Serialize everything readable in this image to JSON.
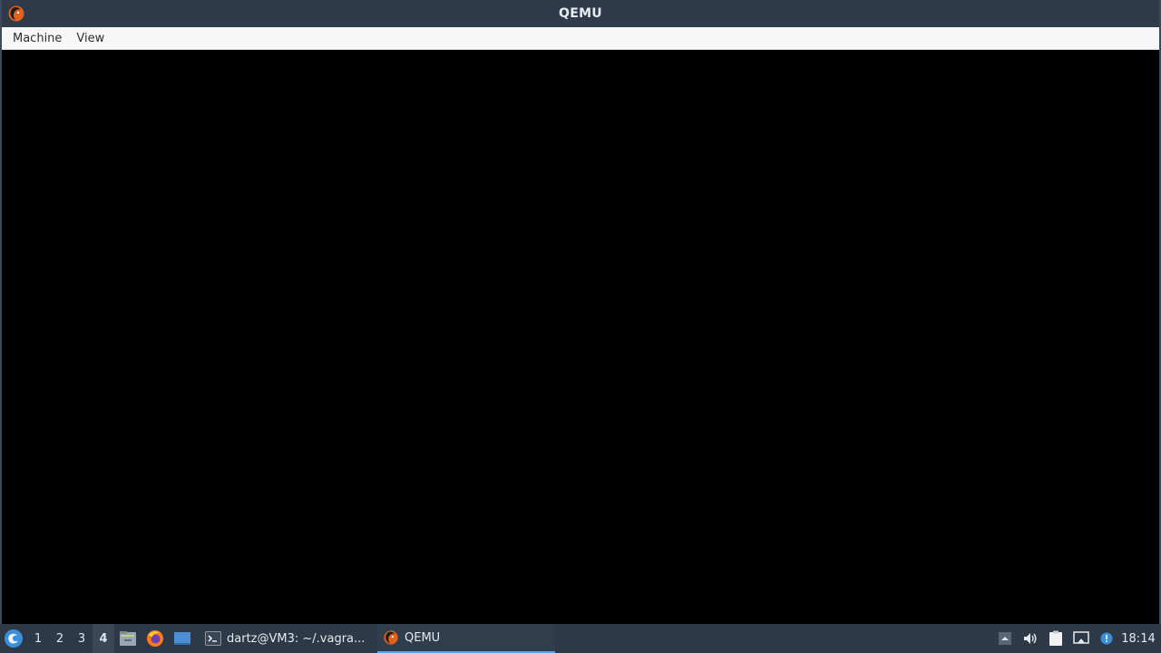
{
  "window": {
    "title": "QEMU",
    "icon": "qemu-icon",
    "menu": [
      {
        "label": "Machine"
      },
      {
        "label": "View"
      }
    ],
    "display_color": "#000000"
  },
  "taskbar": {
    "start_icon": "start-menu-icon",
    "desktops": [
      "1",
      "2",
      "3",
      "4"
    ],
    "active_desktop": "4",
    "launchers": [
      "file-manager-icon",
      "firefox-icon",
      "desktop-icon"
    ],
    "tasks": [
      {
        "label": "dartz@VM3: ~/.vagra...",
        "icon": "terminal-icon"
      },
      {
        "label": "QEMU",
        "icon": "qemu-icon",
        "active": true
      }
    ],
    "tray": [
      "tray-expand-icon",
      "volume-icon",
      "clipboard-icon",
      "network-icon",
      "update-notifier-icon"
    ],
    "clock": "18:14"
  },
  "colors": {
    "titlebar": "#2f3b4a",
    "taskbar": "#2d3946",
    "accent": "#5aa1e6",
    "menubar": "#f7f7f7"
  }
}
